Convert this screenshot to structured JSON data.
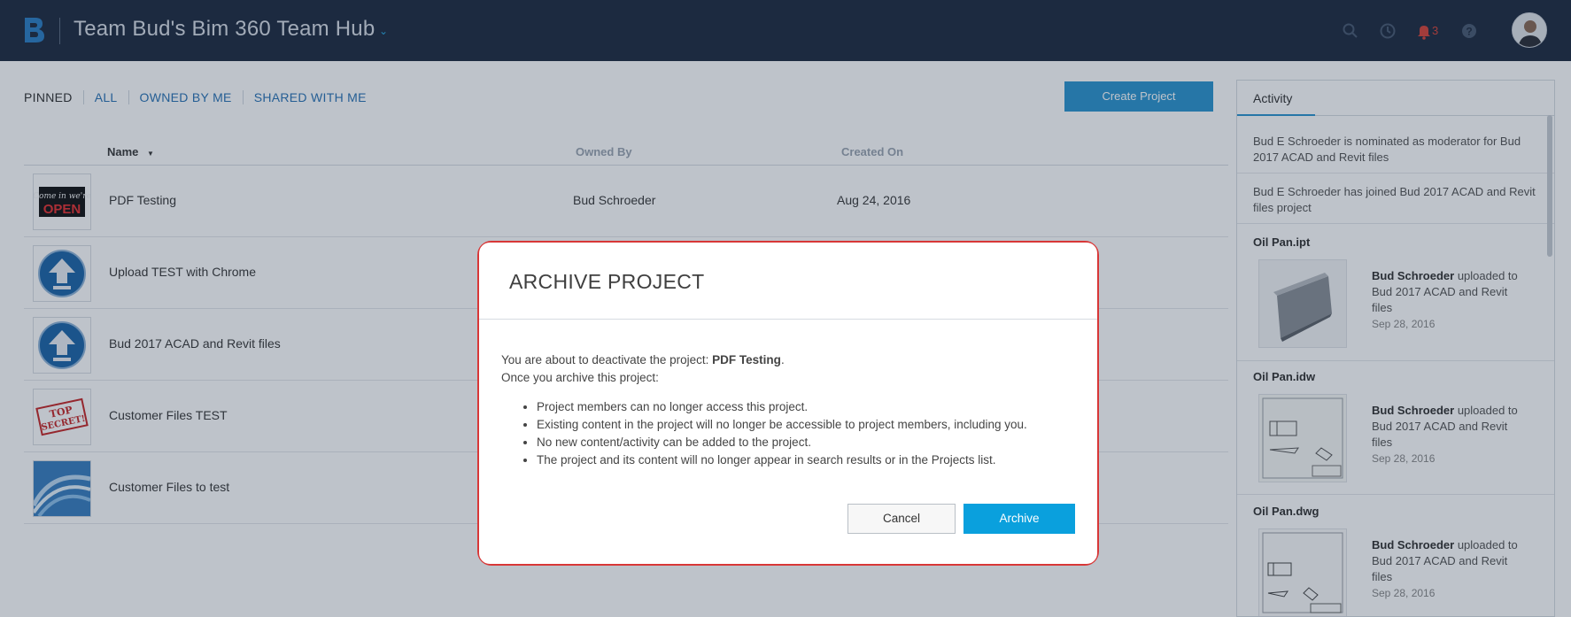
{
  "header": {
    "hub_title": "Team Bud's Bim 360 Team Hub",
    "notification_count": "3",
    "icons": [
      "b-logo-icon",
      "search-icon",
      "clock-icon",
      "bell-icon",
      "help-icon",
      "avatar"
    ]
  },
  "tabs": [
    {
      "label": "PINNED"
    },
    {
      "label": "ALL"
    },
    {
      "label": "OWNED BY ME"
    },
    {
      "label": "SHARED WITH ME"
    }
  ],
  "create_project_label": "Create Project",
  "table": {
    "columns": {
      "name": "Name",
      "sort_indicator": "▼",
      "owned_by": "Owned By",
      "created_on": "Created On"
    },
    "rows": [
      {
        "name": "PDF Testing",
        "owner": "Bud Schroeder",
        "created": "Aug 24, 2016",
        "thumb": "open-sign-icon"
      },
      {
        "name": "Upload TEST with Chrome",
        "owner": "",
        "created": "",
        "thumb": "upload-arrow-icon"
      },
      {
        "name": "Bud 2017 ACAD and Revit files",
        "owner": "",
        "created": "",
        "thumb": "upload-arrow-icon"
      },
      {
        "name": "Customer Files TEST",
        "owner": "",
        "created": "",
        "thumb": "top-secret-stamp-icon"
      },
      {
        "name": "Customer Files to test",
        "owner": "",
        "created": "",
        "thumb": "abstract-swirl-icon"
      }
    ]
  },
  "activity": {
    "tab_label": "Activity",
    "messages": [
      "Bud E Schroeder is nominated as moderator for Bud 2017 ACAD and Revit files",
      "Bud E Schroeder has joined Bud 2017 ACAD and Revit files project"
    ],
    "files": [
      {
        "name": "Oil Pan.ipt",
        "user": "Bud Schroeder",
        "action": "uploaded to Bud 2017 ACAD and Revit files",
        "date": "Sep 28, 2016"
      },
      {
        "name": "Oil Pan.idw",
        "user": "Bud Schroeder",
        "action": "uploaded to Bud 2017 ACAD and Revit files",
        "date": "Sep 28, 2016"
      },
      {
        "name": "Oil Pan.dwg",
        "user": "Bud Schroeder",
        "action": "uploaded to Bud 2017 ACAD and Revit files",
        "date": "Sep 28, 2016"
      }
    ]
  },
  "modal": {
    "title": "ARCHIVE PROJECT",
    "intro_prefix": "You are about to deactivate the project: ",
    "project_name": "PDF Testing",
    "intro_suffix": ".",
    "line2": "Once you archive this project:",
    "bullets": [
      "Project members can no longer access this project.",
      "Existing content in the project will no longer be accessible to project members, including you.",
      "No new content/activity can be added to the project.",
      "The project and its content will no longer appear in search results or in the Projects list."
    ],
    "cancel_label": "Cancel",
    "archive_label": "Archive"
  },
  "colors": {
    "header_bg": "#1f2c40",
    "accent_blue": "#2d95cf",
    "archive_blue": "#0aa0dd",
    "highlight_red": "#d83737",
    "notification_red": "#d7453a"
  }
}
